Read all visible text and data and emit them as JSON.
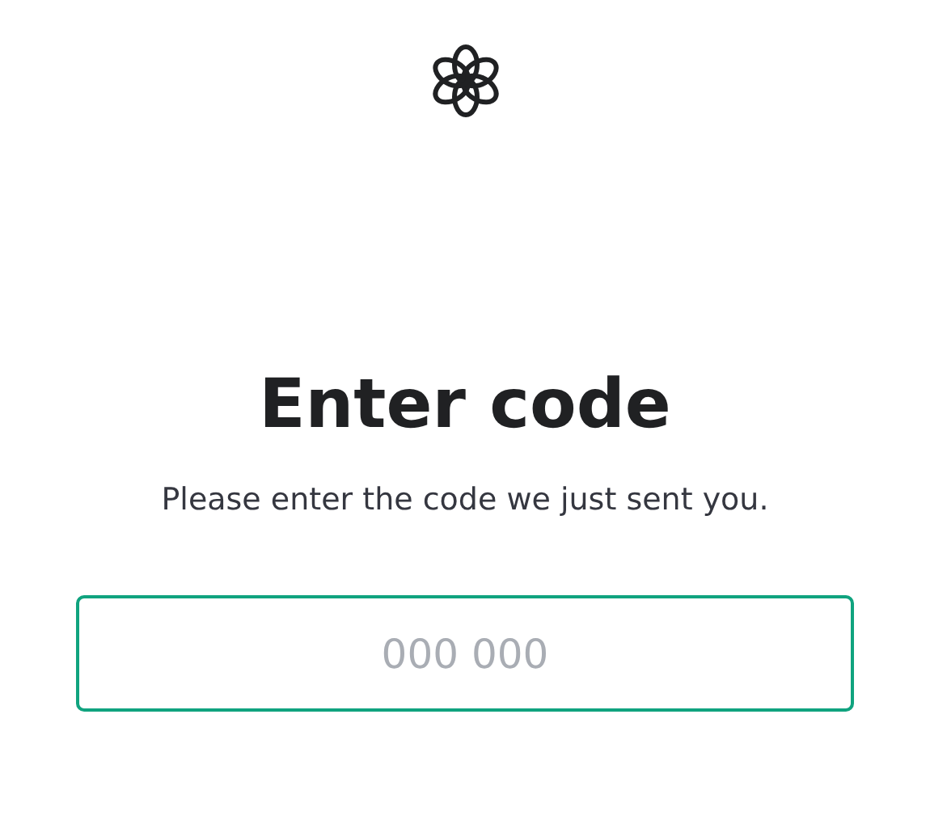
{
  "title": "Enter code",
  "subtitle": "Please enter the code we just sent you.",
  "code_field": {
    "placeholder": "000 000",
    "focused": true
  }
}
